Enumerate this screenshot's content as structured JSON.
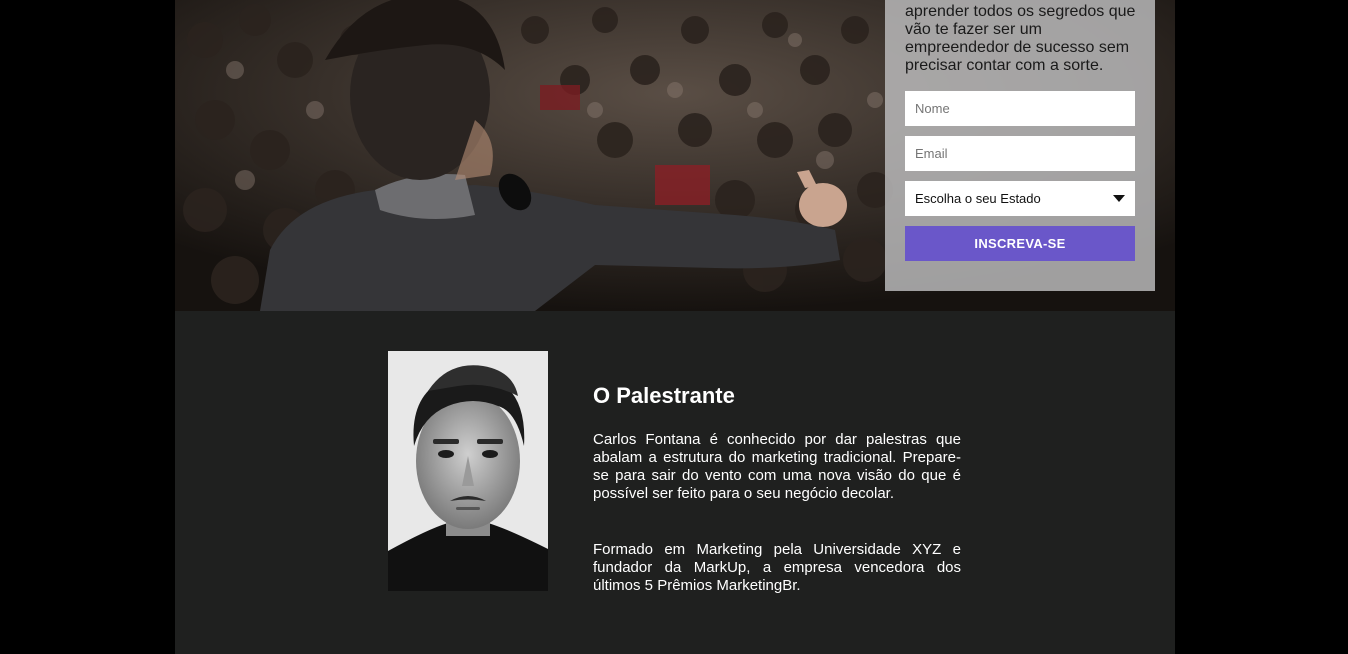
{
  "hero": {
    "form": {
      "intro": "aprender todos os segredos que vão te fazer ser um empreendedor de sucesso sem precisar contar com a sorte.",
      "name_placeholder": "Nome",
      "email_placeholder": "Email",
      "state_select_label": "Escolha o seu Estado",
      "submit_label": "INSCREVA-SE"
    }
  },
  "speaker": {
    "title": "O Palestrante",
    "bio_paragraph_1": "Carlos Fontana é conhecido por dar palestras que abalam a estrutura do marketing tradicional. Prepare-se para sair do vento com uma nova visão do que é possível ser feito para o seu negócio decolar.",
    "bio_paragraph_2": "Formado em Marketing pela Universidade XYZ e fundador da MarkUp, a empresa vencedora dos últimos 5 Prêmios MarketingBr."
  },
  "colors": {
    "accent": "#6a57c9",
    "page_background": "#000000",
    "section_background": "#1f201f"
  },
  "icons": {
    "select_caret": "caret-down-icon"
  }
}
